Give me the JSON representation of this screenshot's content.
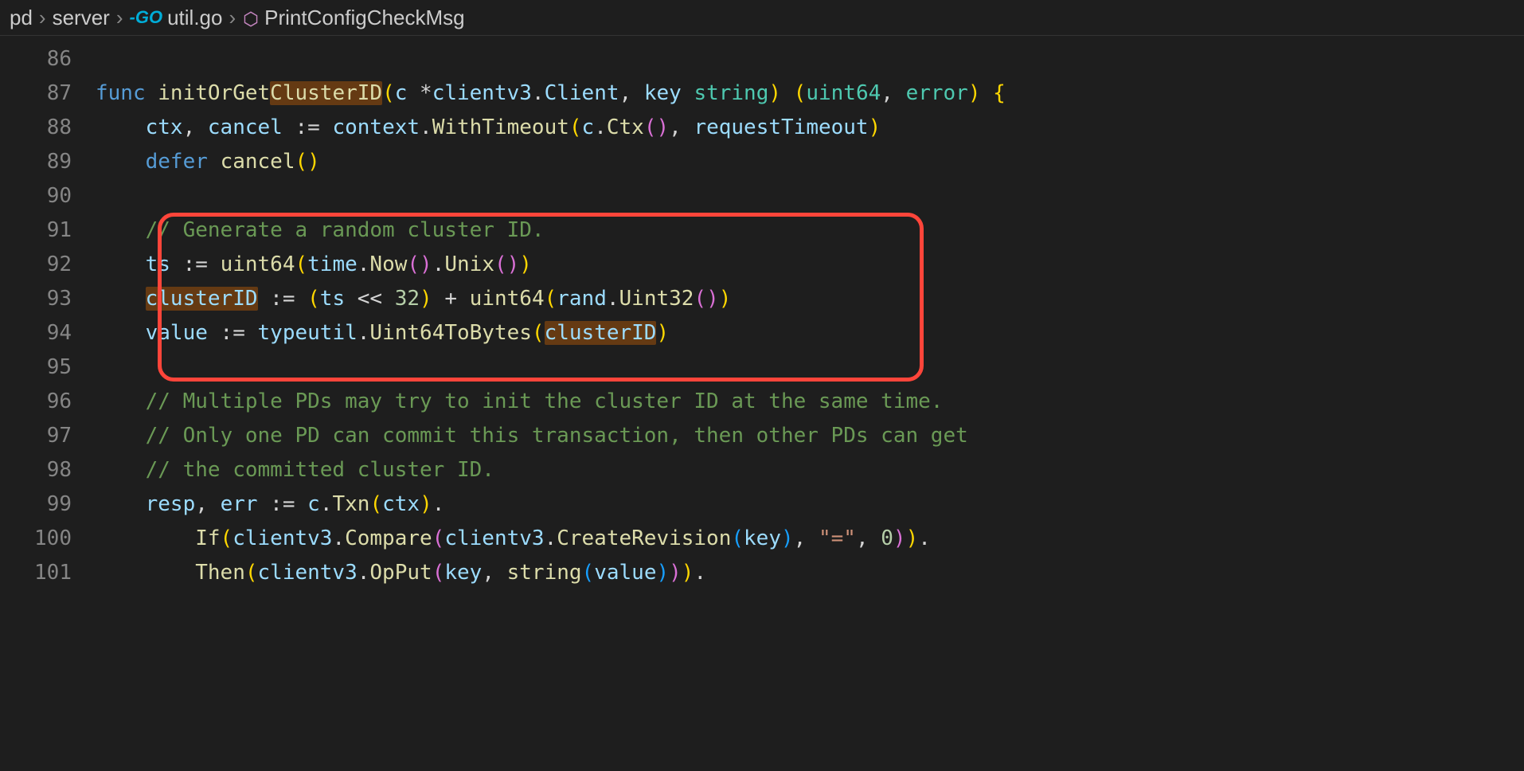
{
  "breadcrumb": {
    "seg1": "pd",
    "seg2": "server",
    "seg3": "util.go",
    "seg4": "PrintConfigCheckMsg"
  },
  "lines": {
    "l86": "86",
    "l87": "87",
    "l88": "88",
    "l89": "89",
    "l90": "90",
    "l91": "91",
    "l92": "92",
    "l93": "93",
    "l94": "94",
    "l95": "95",
    "l96": "96",
    "l97": "97",
    "l98": "98",
    "l99": "99",
    "l100": "100",
    "l101": "101"
  },
  "tok": {
    "func": "func",
    "initOrGet": "initOrGet",
    "ClusterID_hl": "ClusterID",
    "p_c": "c",
    "star": " *",
    "clientv3": "clientv3",
    "dot": ".",
    "Client": "Client",
    "comma": ", ",
    "key": "key",
    "sp": " ",
    "string": "string",
    "uint64": "uint64",
    "error": "error",
    "obrace": " {",
    "ctx": "ctx",
    "cancel": "cancel",
    "ceq": " := ",
    "context": "context",
    "WithTimeout": "WithTimeout",
    "Ctx": "Ctx",
    "requestTimeout": "requestTimeout",
    "defer": "defer",
    "cmt91": "// Generate a random cluster ID.",
    "ts": "ts",
    "time": "time",
    "Now": "Now",
    "Unix": "Unix",
    "clusterID": "clusterID",
    "shift": " << ",
    "n32": "32",
    "plus": " + ",
    "rand": "rand",
    "Uint32": "Uint32",
    "value": "value",
    "typeutil": "typeutil",
    "Uint64ToBytes": "Uint64ToBytes",
    "cmt96": "// Multiple PDs may try to init the cluster ID at the same time.",
    "cmt97": "// Only one PD can commit this transaction, then other PDs can get",
    "cmt98": "// the committed cluster ID.",
    "resp": "resp",
    "err": "err",
    "Txn": "Txn",
    "If": "If",
    "Compare": "Compare",
    "CreateRevision": "CreateRevision",
    "eq_str": "\"=\"",
    "zero": "0",
    "Then": "Then",
    "OpPut": "OpPut",
    "c": "c",
    "op": "(",
    "cp": ")",
    "empty_pair": "()"
  }
}
